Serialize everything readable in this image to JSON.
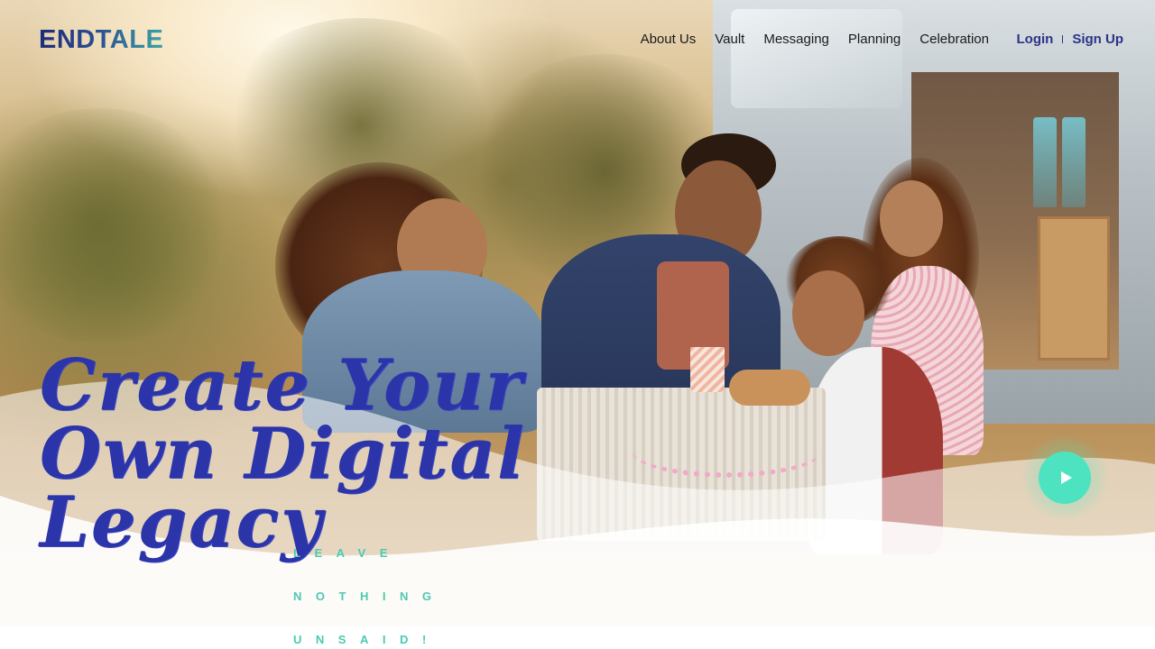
{
  "brand": {
    "logo_text": "ENDTALE"
  },
  "nav": {
    "items": [
      {
        "label": "About Us"
      },
      {
        "label": "Vault"
      },
      {
        "label": "Messaging"
      },
      {
        "label": "Planning"
      },
      {
        "label": "Celebration"
      }
    ]
  },
  "auth": {
    "login_label": "Login",
    "signup_label": "Sign Up"
  },
  "hero": {
    "headline_lines": [
      "Create Your",
      "Own Digital",
      "Legacy"
    ],
    "tagline_lines": [
      "LEAVE",
      "NOTHING",
      "UNSAID!"
    ],
    "play_icon": "play-icon"
  },
  "colors": {
    "headline": "#2b34a8",
    "tagline": "#4cc9b2",
    "nav_auth": "#2c3486",
    "play_button": "#4de3c1"
  }
}
